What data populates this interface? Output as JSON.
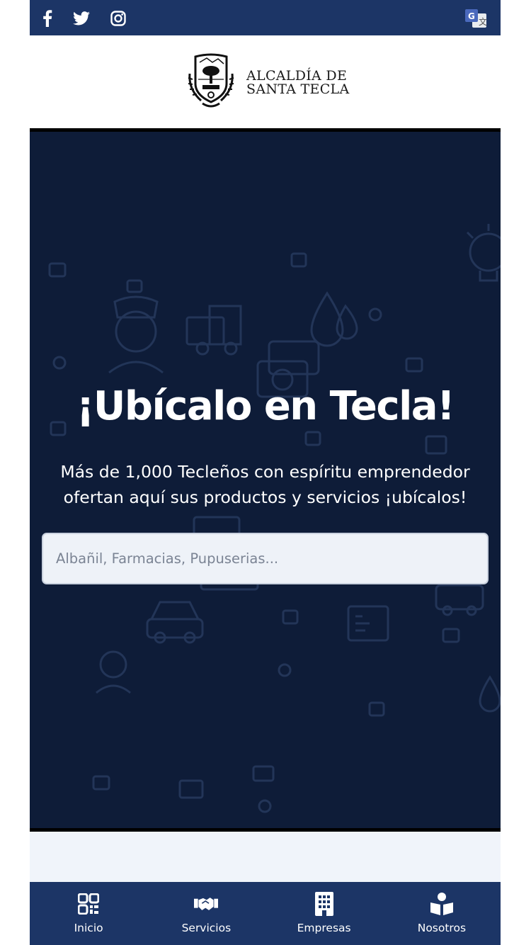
{
  "topbar": {
    "social": [
      {
        "name": "facebook-icon"
      },
      {
        "name": "twitter-icon"
      },
      {
        "name": "instagram-icon"
      }
    ],
    "translate_icon": "google-translate-icon",
    "translate_letter": "G"
  },
  "logo": {
    "line1": "ALCALDÍA DE",
    "line2": "SANTA TECLA"
  },
  "hero": {
    "title": "¡Ubícalo en Tecla!",
    "subtitle": "Más de 1,000 Tecleños con espíritu emprendedor ofertan aquí sus productos y servicios ¡ubícalos!",
    "search_placeholder": "Albañil, Farmacias, Pupuserias..."
  },
  "nav": {
    "items": [
      {
        "label": "Inicio",
        "icon": "qr-code-icon"
      },
      {
        "label": "Servicios",
        "icon": "handshake-icon"
      },
      {
        "label": "Empresas",
        "icon": "building-icon"
      },
      {
        "label": "Nosotros",
        "icon": "reader-icon"
      }
    ]
  },
  "colors": {
    "navy": "#1c3566",
    "hero_bg": "#0e1c38",
    "light_bg": "#f0f4fa"
  }
}
